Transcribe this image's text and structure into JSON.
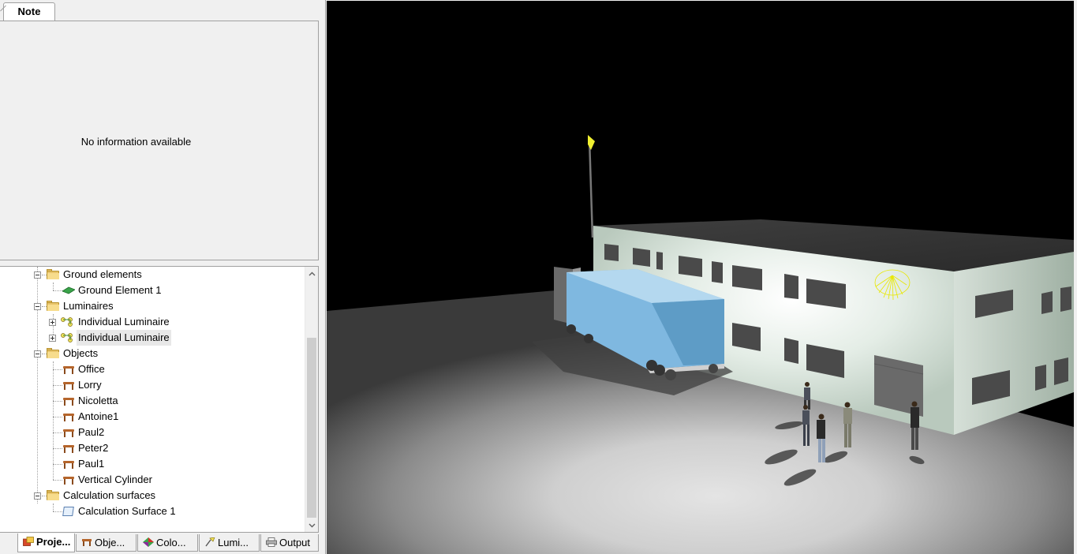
{
  "note": {
    "tab_label": "Note",
    "message": "No information available"
  },
  "tree": {
    "items": [
      {
        "label": "Ground elements",
        "type": "folder"
      },
      {
        "label": "Ground Element 1",
        "type": "ground"
      },
      {
        "label": "Luminaires",
        "type": "folder"
      },
      {
        "label": "Individual Luminaire",
        "type": "luminaire"
      },
      {
        "label": "Individual Luminaire",
        "type": "luminaire",
        "selected": true
      },
      {
        "label": "Objects",
        "type": "folder"
      },
      {
        "label": "Office",
        "type": "object"
      },
      {
        "label": "Lorry",
        "type": "object"
      },
      {
        "label": "Nicoletta",
        "type": "object"
      },
      {
        "label": "Antoine1",
        "type": "object"
      },
      {
        "label": "Paul2",
        "type": "object"
      },
      {
        "label": "Peter2",
        "type": "object"
      },
      {
        "label": "Paul1",
        "type": "object"
      },
      {
        "label": "Vertical Cylinder",
        "type": "object"
      },
      {
        "label": "Calculation surfaces",
        "type": "folder"
      },
      {
        "label": "Calculation Surface 1",
        "type": "calc"
      }
    ]
  },
  "bottom_tabs": [
    {
      "label": "Proje...",
      "icon": "project-icon",
      "active": true
    },
    {
      "label": "Obje...",
      "icon": "objects-icon"
    },
    {
      "label": "Colo...",
      "icon": "colors-icon"
    },
    {
      "label": "Lumi...",
      "icon": "luminaires-icon"
    },
    {
      "label": "Output",
      "icon": "printer-icon"
    }
  ],
  "colors": {
    "folder": "#e8c46a",
    "selection": "#e8e8e8",
    "viewport_bg": "#000000",
    "lorry_container": "#7fb8e0",
    "luminaire_highlight": "#ffff00"
  }
}
